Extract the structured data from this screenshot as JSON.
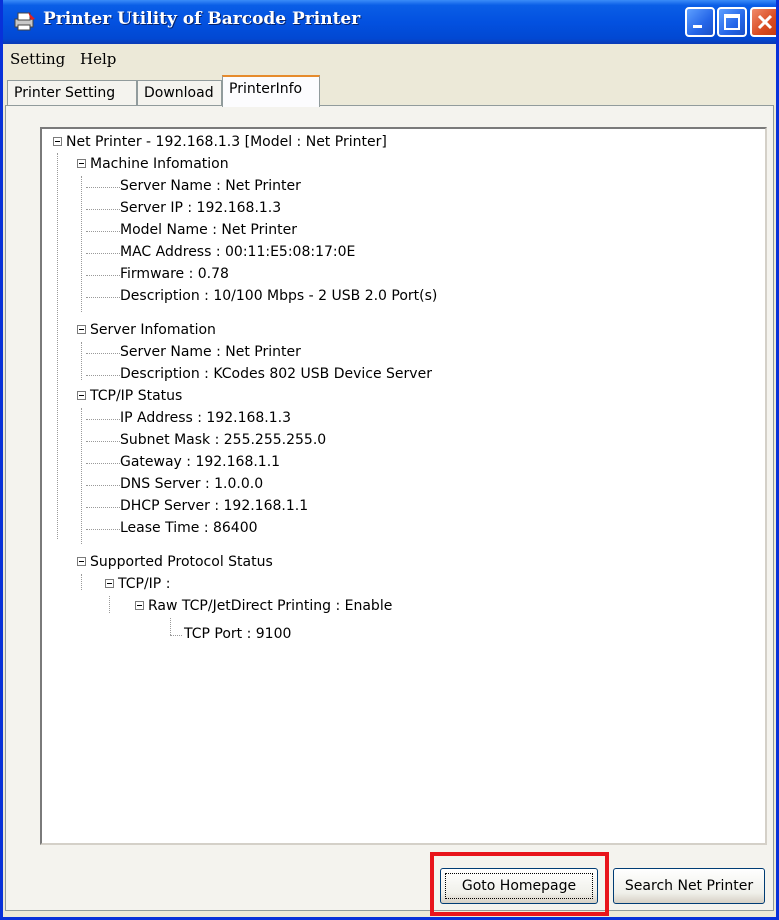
{
  "window": {
    "title": "Printer Utility of Barcode Printer",
    "icon": "printer-app-icon",
    "accent": "#0351e0"
  },
  "menu": [
    "Setting",
    "Help"
  ],
  "tabs": [
    {
      "label": "Printer Setting",
      "active": false
    },
    {
      "label": "Download",
      "active": false
    },
    {
      "label": "PrinterInfo",
      "active": true
    }
  ],
  "tree": {
    "root": "Net Printer - 192.168.1.3 [Model : Net Printer]",
    "machine": {
      "label": "Machine Infomation",
      "items": [
        "Server Name : Net Printer",
        "Server IP : 192.168.1.3",
        "Model Name : Net Printer",
        "MAC Address : 00:11:E5:08:17:0E",
        "Firmware : 0.78",
        "Description : 10/100 Mbps - 2 USB 2.0 Port(s)"
      ]
    },
    "server": {
      "label": "Server Infomation",
      "items": [
        "Server Name : Net Printer",
        "Description : KCodes 802 USB Device Server"
      ]
    },
    "tcpip": {
      "label": "TCP/IP Status",
      "items": [
        "IP Address : 192.168.1.3",
        "Subnet Mask : 255.255.255.0",
        "Gateway : 192.168.1.1",
        "DNS Server : 1.0.0.0",
        "DHCP Server : 192.168.1.1",
        "Lease Time : 86400"
      ]
    },
    "protocol": {
      "label": "Supported Protocol Status",
      "tcpip": "TCP/IP :",
      "raw": "Raw TCP/JetDirect Printing : Enable",
      "port": "TCP Port : 9100"
    }
  },
  "buttons": {
    "goto": "Goto Homepage",
    "search": "Search Net Printer"
  },
  "highlight_color": "#e8141b"
}
